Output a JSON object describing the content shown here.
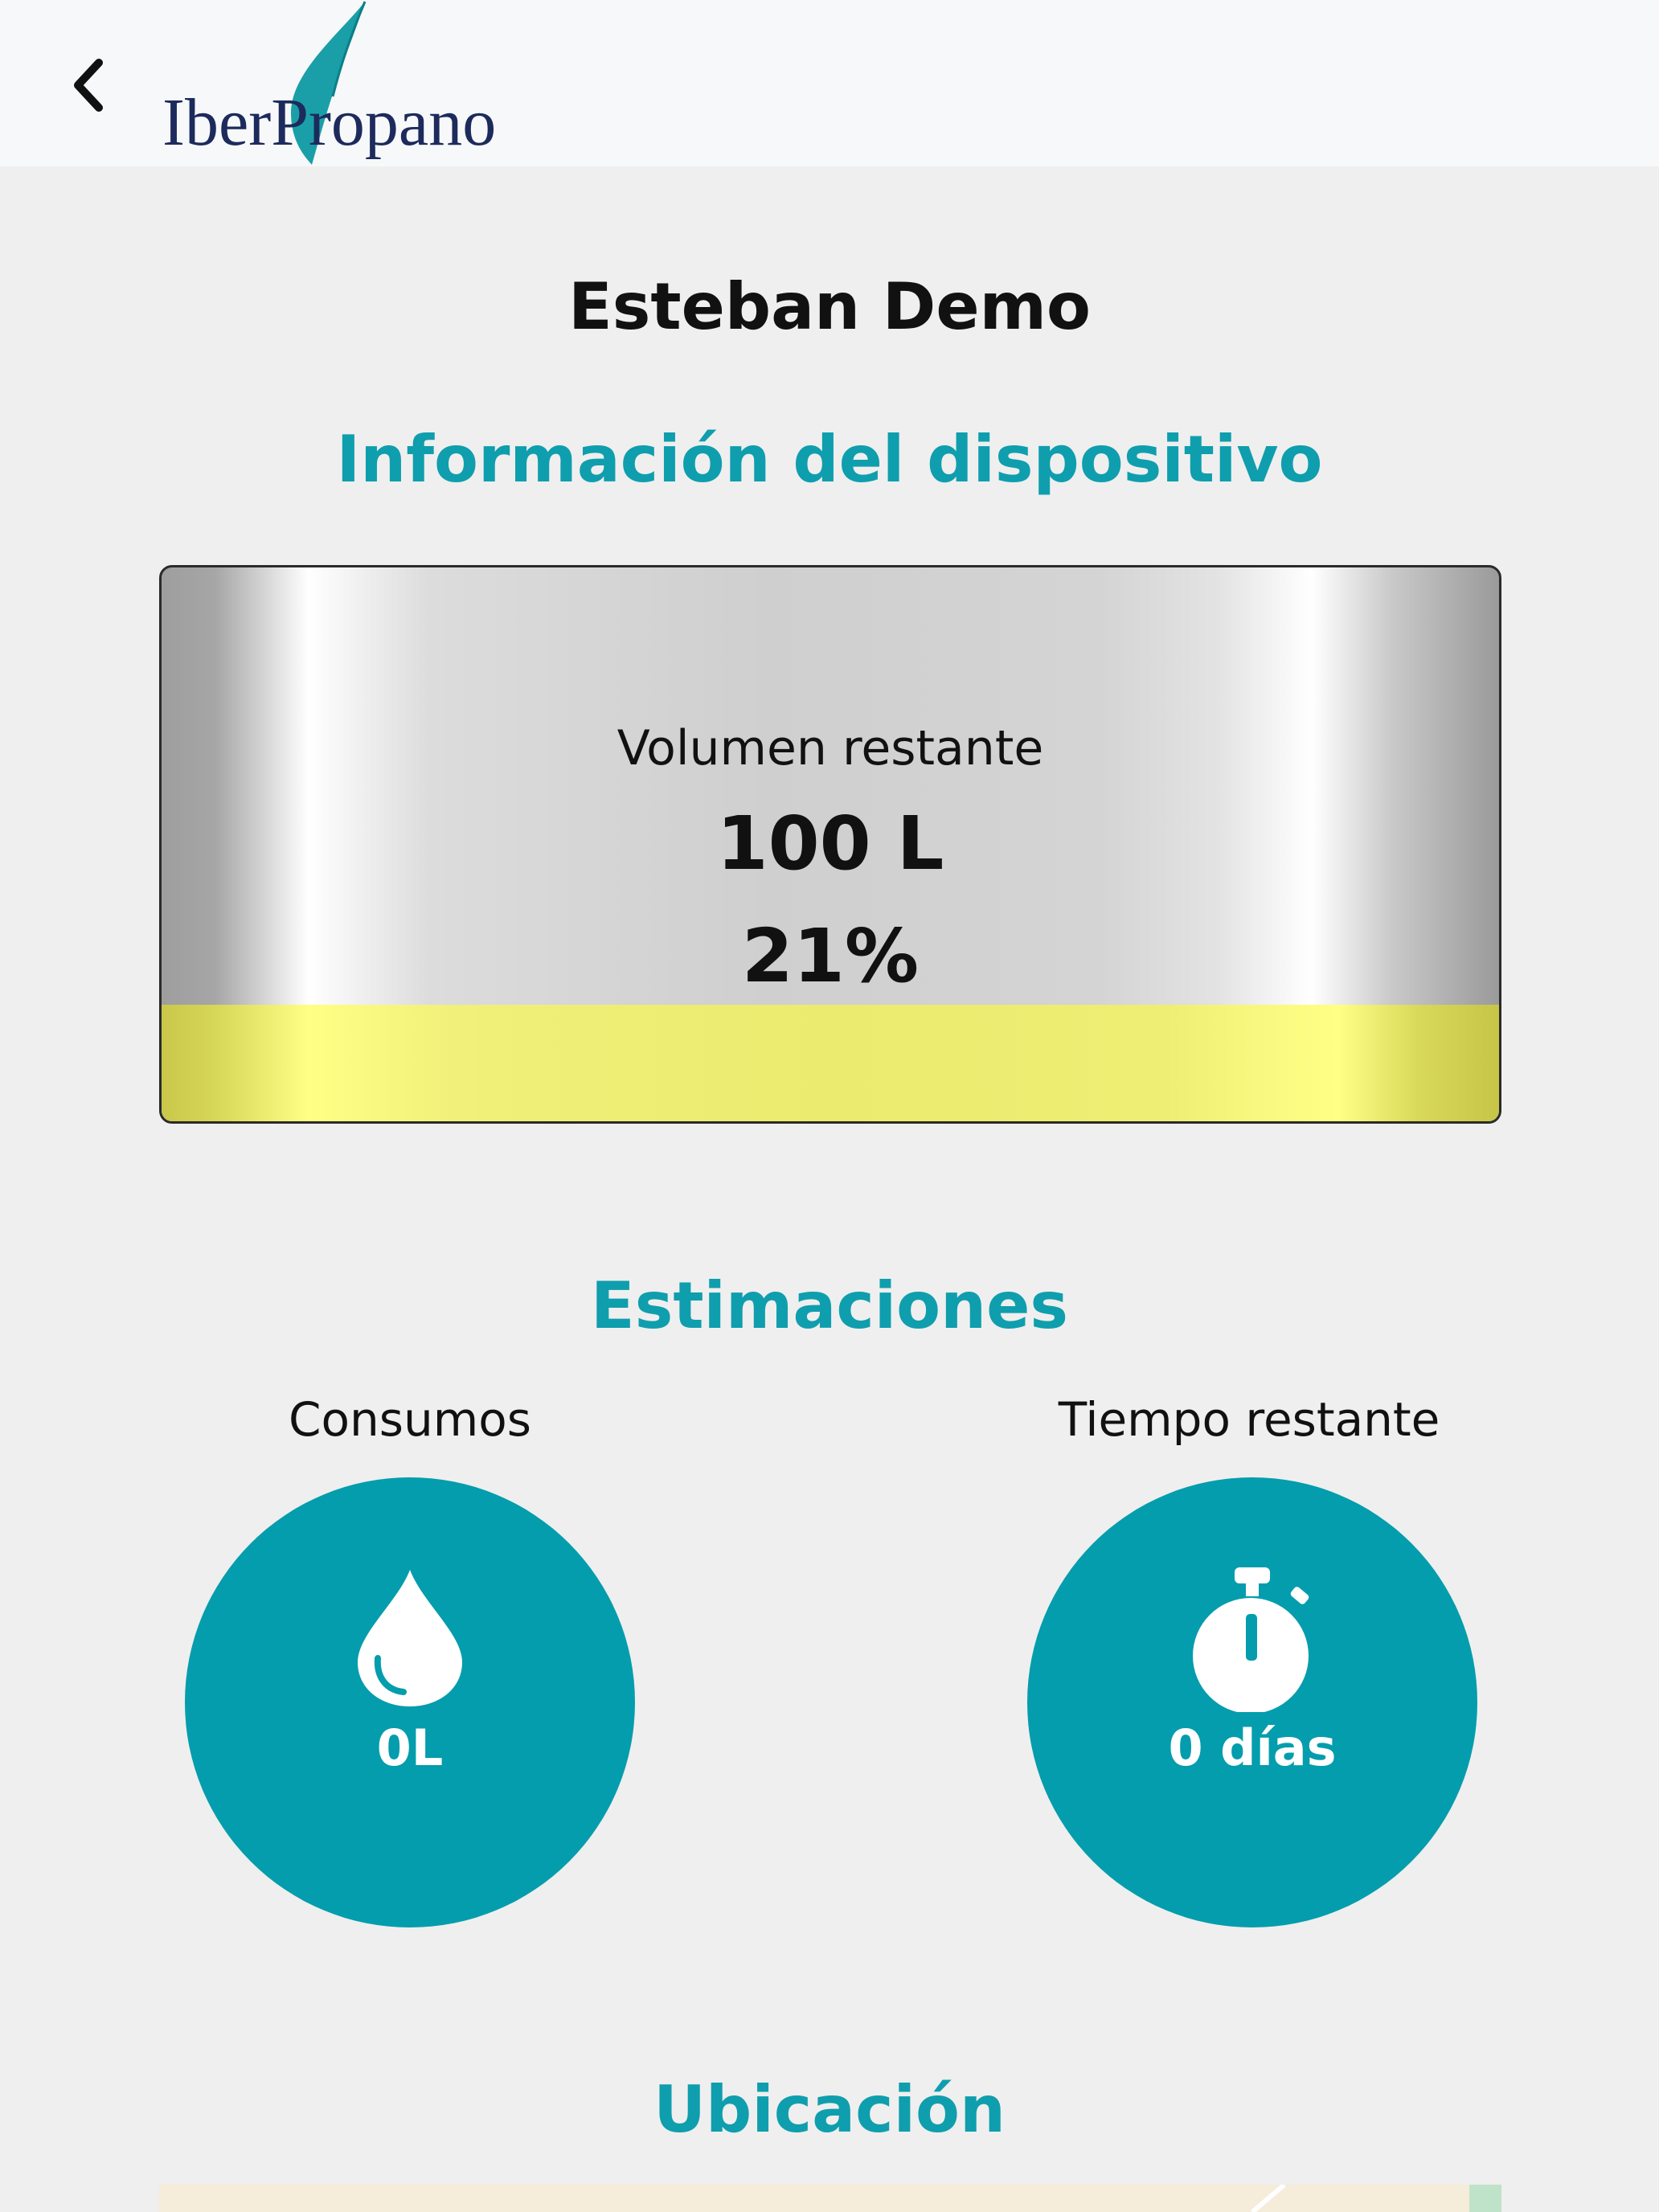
{
  "header": {
    "logo_text_1": "Iber",
    "logo_text_2": "Propano"
  },
  "user": {
    "name": "Esteban Demo"
  },
  "device_info": {
    "title": "Información del dispositivo",
    "volume_label": "Volumen restante",
    "volume_value": "100 L",
    "percent_value": "21%",
    "fill_fraction": 0.21
  },
  "estimates": {
    "title": "Estimaciones",
    "consumption": {
      "label": "Consumos",
      "value": "0L",
      "icon": "water-drop-icon"
    },
    "remaining_time": {
      "label": "Tiempo restante",
      "value": "0 días",
      "icon": "stopwatch-icon"
    }
  },
  "location": {
    "title": "Ubicación"
  },
  "colors": {
    "accent": "#0f9ead",
    "circle": "#049dad",
    "fill": "#ffff86"
  }
}
